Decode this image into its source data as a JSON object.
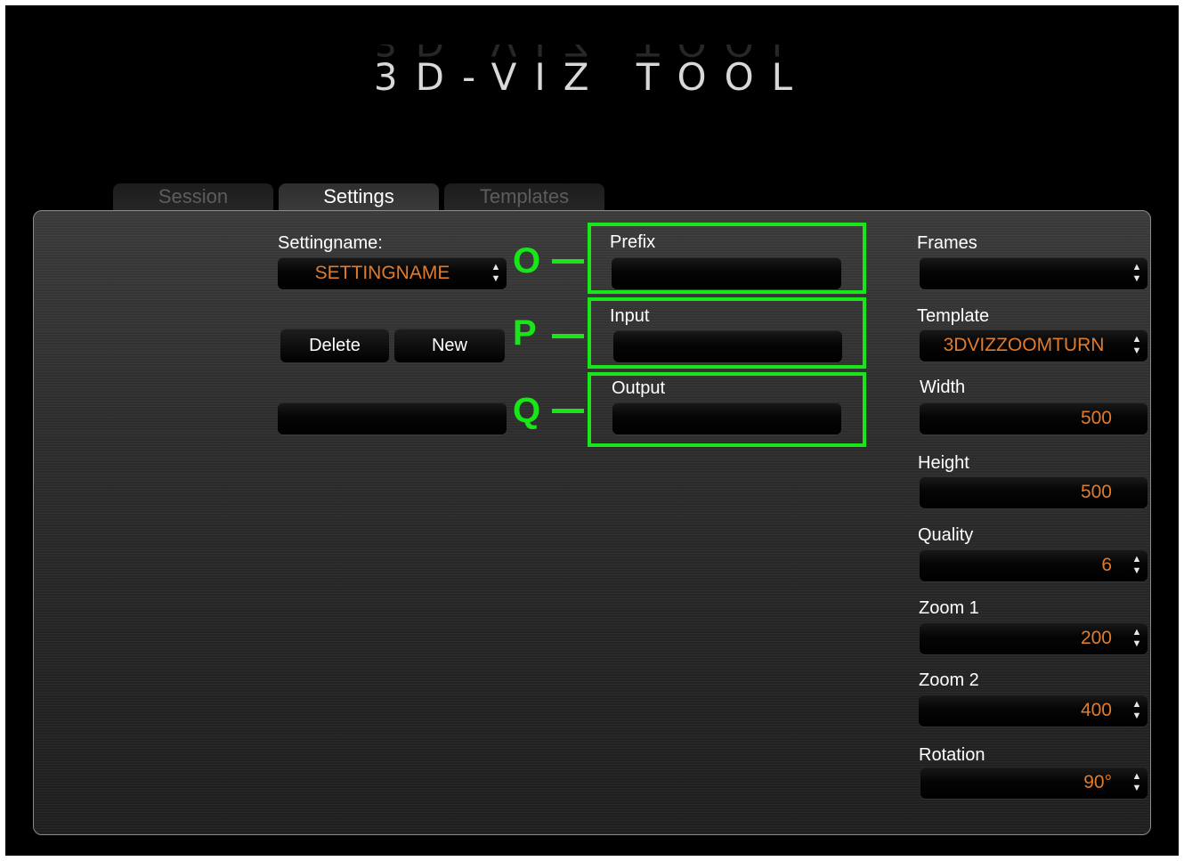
{
  "app": {
    "title": "3D-VIZ TOOL"
  },
  "tabs": [
    {
      "label": "Session",
      "active": false
    },
    {
      "label": "Settings",
      "active": true
    },
    {
      "label": "Templates",
      "active": false
    }
  ],
  "left": {
    "settingname_label": "Settingname:",
    "settingname_value": "SETTINGNAME",
    "delete_label": "Delete",
    "new_label": "New",
    "extra_value": ""
  },
  "middle": {
    "prefix_label": "Prefix",
    "prefix_value": "",
    "input_label": "Input",
    "input_value": "",
    "output_label": "Output",
    "output_value": ""
  },
  "right": {
    "frames_label": "Frames",
    "frames_value": "",
    "template_label": "Template",
    "template_value": "3DVIZZOOMTURN",
    "width_label": "Width",
    "width_value": "500",
    "height_label": "Height",
    "height_value": "500",
    "quality_label": "Quality",
    "quality_value": "6",
    "zoom1_label": "Zoom 1",
    "zoom1_value": "200",
    "zoom2_label": "Zoom 2",
    "zoom2_value": "400",
    "rotation_label": "Rotation",
    "rotation_value": "90°"
  },
  "annotations": [
    {
      "letter": "O",
      "target": "prefix"
    },
    {
      "letter": "P",
      "target": "input"
    },
    {
      "letter": "Q",
      "target": "output"
    }
  ],
  "colors": {
    "value_text": "#e07b2c",
    "annotation": "#19e619"
  },
  "icons": {
    "spinner": "up-down-arrows-icon"
  }
}
